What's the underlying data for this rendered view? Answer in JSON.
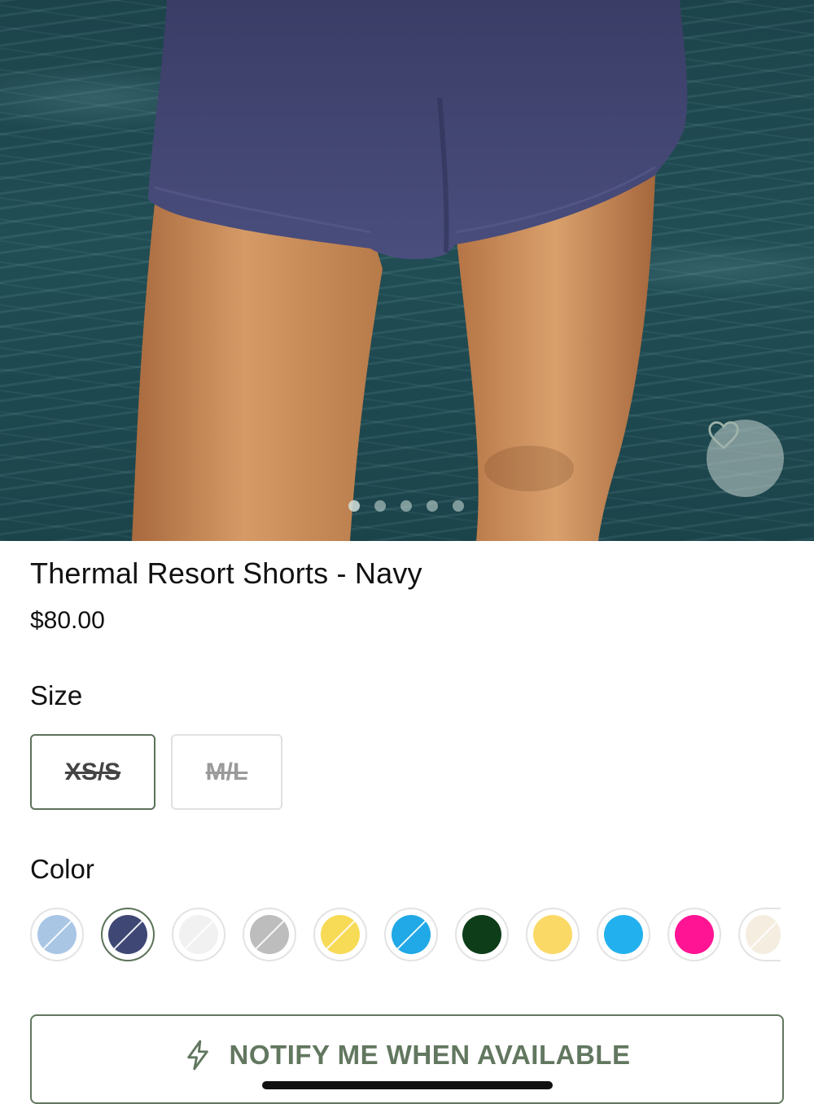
{
  "hero": {
    "image_alt": "Navy thermal shorts worn by a model in front of water",
    "carousel_count": 5,
    "carousel_active": 0
  },
  "favorite": {
    "icon": "heart-icon"
  },
  "product": {
    "title": "Thermal Resort Shorts - Navy",
    "price": "$80.00"
  },
  "size": {
    "label": "Size",
    "options": [
      {
        "label": "XS/S",
        "selected": true,
        "available": false
      },
      {
        "label": "M/L",
        "selected": false,
        "available": false
      }
    ]
  },
  "color": {
    "label": "Color",
    "swatches": [
      {
        "color": "#a9c6e5",
        "available": false,
        "selected": false
      },
      {
        "color": "#3f4775",
        "available": false,
        "selected": true
      },
      {
        "color": "#f1f1f1",
        "available": false,
        "selected": false
      },
      {
        "color": "#bdbdbd",
        "available": false,
        "selected": false
      },
      {
        "color": "#f7da55",
        "available": false,
        "selected": false
      },
      {
        "color": "#21a8e6",
        "available": false,
        "selected": false
      },
      {
        "color": "#0d3d19",
        "available": true,
        "selected": false
      },
      {
        "color": "#fbd967",
        "available": true,
        "selected": false
      },
      {
        "color": "#22b1ee",
        "available": true,
        "selected": false
      },
      {
        "color": "#ff1493",
        "available": true,
        "selected": false
      },
      {
        "color": "#f4ede0",
        "available": false,
        "selected": false
      }
    ]
  },
  "cta": {
    "label": "NOTIFY ME WHEN AVAILABLE",
    "icon": "lightning-icon",
    "accent": "#62775f"
  }
}
